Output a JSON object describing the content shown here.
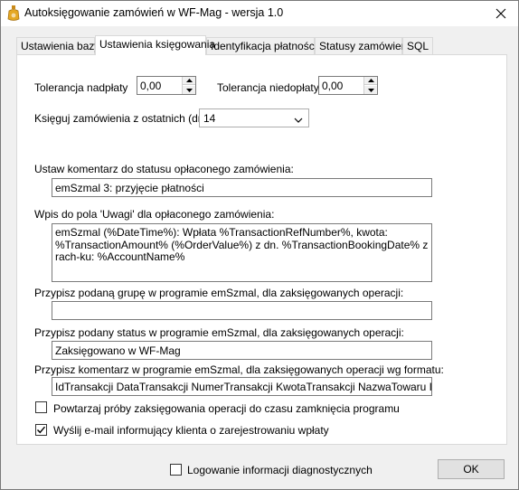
{
  "window": {
    "title": "Autoksięgowanie zamówień w WF-Mag - wersja 1.0"
  },
  "tabs": [
    {
      "label": "Ustawienia bazy"
    },
    {
      "label": "Ustawienia księgowania"
    },
    {
      "label": "Identyfikacja płatności"
    },
    {
      "label": "Statusy zamówień"
    },
    {
      "label": "SQL"
    }
  ],
  "active_tab": "Ustawienia księgowania",
  "settings": {
    "overpay_label": "Tolerancja nadpłaty",
    "overpay_value": "0,00",
    "underpay_label": "Tolerancja niedopłaty",
    "underpay_value": "0,00",
    "days_label": "Księguj zamówienia z ostatnich (dni):",
    "days_value": "14",
    "status_comment_label": "Ustaw komentarz do statusu opłaconego zamówienia:",
    "status_comment_value": "emSzmal 3: przyjęcie płatności",
    "notes_label": "Wpis do pola 'Uwagi' dla opłaconego zamówienia:",
    "notes_value": "emSzmal (%DateTime%): Wpłata %TransactionRefNumber%, kwota: %TransactionAmount% (%OrderValue%) z dn. %TransactionBookingDate% z rach-ku: %AccountName%",
    "group_label": "Przypisz podaną grupę w programie emSzmal, dla zaksięgowanych operacji:",
    "group_value": "",
    "status_label": "Przypisz podany status w programie emSzmal, dla zaksięgowanych operacji:",
    "status_value": "Zaksięgowano w WF-Mag",
    "format_label": "Przypisz komentarz w programie emSzmal, dla zaksięgowanych operacji wg formatu:",
    "format_value": "IdTransakcji DataTransakcji NumerTransakcji KwotaTransakcji NazwaTowaru IdKlienta",
    "retry_label": "Powtarzaj próby zaksięgowania operacji do czasu zamknięcia programu",
    "retry_checked": false,
    "email_label": "Wyślij e-mail informujący klienta o zarejestrowaniu wpłaty",
    "email_checked": true
  },
  "footer": {
    "diag_label": "Logowanie informacji diagnostycznych",
    "diag_checked": false,
    "ok_label": "OK"
  },
  "icons": {
    "app": "app-icon",
    "close": "close-icon",
    "spin_up": "spin-up-icon",
    "spin_down": "spin-down-icon",
    "dropdown": "chevron-down-icon",
    "check": "checkmark-icon"
  }
}
